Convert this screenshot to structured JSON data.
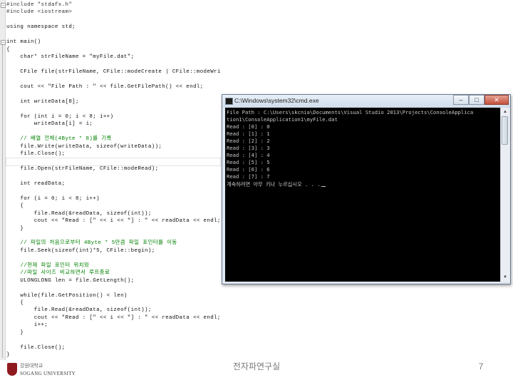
{
  "editor": {
    "lines": [
      {
        "text": "#include \"stdafx.h\"",
        "kind": "preproc"
      },
      {
        "text": "#include <iostream>",
        "kind": "preproc"
      },
      {
        "text": "",
        "kind": "code"
      },
      {
        "text": "using namespace std;",
        "kind": "code"
      },
      {
        "text": "",
        "kind": "code"
      },
      {
        "text": "int main()",
        "kind": "code"
      },
      {
        "text": "{",
        "kind": "code"
      },
      {
        "text": "    char* strFileName = \"myFile.dat\";",
        "kind": "code"
      },
      {
        "text": "",
        "kind": "code"
      },
      {
        "text": "    CFile file(strFileName, CFile::modeCreate | CFile::modeWrite);",
        "kind": "code"
      },
      {
        "text": "",
        "kind": "code"
      },
      {
        "text": "    cout << \"File Path : \" << file.GetFilePath() << endl;",
        "kind": "code"
      },
      {
        "text": "",
        "kind": "code"
      },
      {
        "text": "    int writeData[8];",
        "kind": "code"
      },
      {
        "text": "",
        "kind": "code"
      },
      {
        "text": "    for (int i = 0; i < 8; i++)",
        "kind": "code"
      },
      {
        "text": "        writeData[i] = i;",
        "kind": "code"
      },
      {
        "text": "",
        "kind": "code"
      },
      {
        "text": "    // 배열 전체(4Byte * 8)를 기록",
        "kind": "comment"
      },
      {
        "text": "    file.Write(writeData, sizeof(writeData));",
        "kind": "code"
      },
      {
        "text": "    file.Close();",
        "kind": "code"
      },
      {
        "text": "",
        "kind": "current"
      },
      {
        "text": "    file.Open(strFileName, CFile::modeRead);",
        "kind": "code"
      },
      {
        "text": "",
        "kind": "code"
      },
      {
        "text": "    int readData;",
        "kind": "code"
      },
      {
        "text": "",
        "kind": "code"
      },
      {
        "text": "    for (i = 0; i < 8; i++)",
        "kind": "code"
      },
      {
        "text": "    {",
        "kind": "code"
      },
      {
        "text": "        file.Read(&readData, sizeof(int));",
        "kind": "code"
      },
      {
        "text": "        cout << \"Read : [\" << i << \"] : \" << readData << endl;",
        "kind": "code"
      },
      {
        "text": "    }",
        "kind": "code"
      },
      {
        "text": "",
        "kind": "code"
      },
      {
        "text": "    // 파일의 처음으로부터 4Byte * 5만큼 파일 포인터를 이동",
        "kind": "comment"
      },
      {
        "text": "    file.Seek(sizeof(int)*5, CFile::begin);",
        "kind": "code"
      },
      {
        "text": "",
        "kind": "code"
      },
      {
        "text": "    //현재 파일 포인터 위치와",
        "kind": "comment"
      },
      {
        "text": "    //파일 사이즈 비교하면서 루프종료",
        "kind": "comment"
      },
      {
        "text": "    ULONGLONG len = file.GetLength();",
        "kind": "code"
      },
      {
        "text": "",
        "kind": "code"
      },
      {
        "text": "    while(file.GetPosition() < len)",
        "kind": "code"
      },
      {
        "text": "    {",
        "kind": "code"
      },
      {
        "text": "        file.Read(&readData, sizeof(int));",
        "kind": "code"
      },
      {
        "text": "        cout << \"Read : [\" << i << \"] : \" << readData << endl;",
        "kind": "code"
      },
      {
        "text": "        i++;",
        "kind": "code"
      },
      {
        "text": "    }",
        "kind": "code"
      },
      {
        "text": "",
        "kind": "code"
      },
      {
        "text": "    file.Close();",
        "kind": "code"
      },
      {
        "text": "}",
        "kind": "code"
      }
    ]
  },
  "console": {
    "title": "C:\\Windows\\system32\\cmd.exe",
    "controls": {
      "minimize": "–",
      "maximize": "□",
      "close": "✕"
    },
    "scroll_up": "▲",
    "scroll_down": "▼",
    "lines": [
      "File Path : C:\\Users\\skcnia\\Documents\\Visual Studio 2013\\Projects\\ConsoleApplica",
      "tion1\\ConsoleApplication1\\myFile.dat",
      "Read : [0] : 0",
      "Read : [1] : 1",
      "Read : [2] : 2",
      "Read : [3] : 3",
      "Read : [4] : 4",
      "Read : [5] : 5",
      "Read : [6] : 6",
      "Read : [7] : 7",
      "계속하려면 아무 키나 누르십시오 . . ."
    ]
  },
  "footer": {
    "logo_kr": "강원대학교",
    "logo_en": "SOGANG UNIVERSITY",
    "center_text": "전자파연구실",
    "page_number": "7"
  },
  "colors": {
    "comment": "#008000",
    "console_bg": "#000000",
    "console_text": "#c8c8c8",
    "logo_red": "#8e1a1f"
  }
}
